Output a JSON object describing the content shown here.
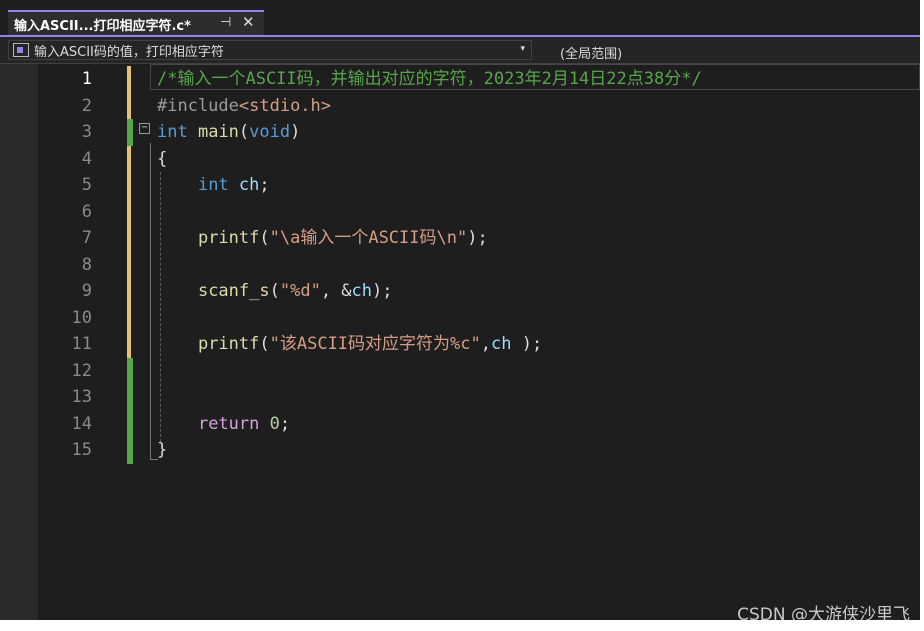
{
  "tab": {
    "title": "输入ASCII...打印相应字符.c*",
    "pin_glyph": "⊣",
    "close_glyph": "✕",
    "accent_color": "#9184ee"
  },
  "navbar": {
    "scope_text": "输入ASCII码的值，打印相应字符",
    "dropdown_arrow": "▾",
    "global_scope": "(全局范围)"
  },
  "editor": {
    "line_numbers": [
      "1",
      "2",
      "3",
      "4",
      "5",
      "6",
      "7",
      "8",
      "9",
      "10",
      "11",
      "12",
      "13",
      "14",
      "15"
    ],
    "active_line": 1,
    "fold_glyph": "−",
    "lines": [
      [
        {
          "t": "/*输入一个ASCII码，并输出对应的字符，2023年2月14日22点38分*/",
          "c": "c-comment"
        }
      ],
      [
        {
          "t": "#include",
          "c": "c-pre"
        },
        {
          "t": "<stdio.h>",
          "c": "c-header"
        }
      ],
      [
        {
          "t": "int",
          "c": "c-type"
        },
        {
          "t": " ",
          "c": "c-punct"
        },
        {
          "t": "main",
          "c": "c-func"
        },
        {
          "t": "(",
          "c": "c-punct"
        },
        {
          "t": "void",
          "c": "c-type"
        },
        {
          "t": ")",
          "c": "c-punct"
        }
      ],
      [
        {
          "t": "{",
          "c": "c-punct"
        }
      ],
      [
        {
          "t": "    ",
          "c": "c-punct"
        },
        {
          "t": "int",
          "c": "c-type"
        },
        {
          "t": " ",
          "c": "c-punct"
        },
        {
          "t": "ch",
          "c": "c-var"
        },
        {
          "t": ";",
          "c": "c-punct"
        }
      ],
      [],
      [
        {
          "t": "    ",
          "c": "c-punct"
        },
        {
          "t": "printf",
          "c": "c-func"
        },
        {
          "t": "(",
          "c": "c-punct"
        },
        {
          "t": "\"\\a输入一个ASCII码\\n\"",
          "c": "c-str"
        },
        {
          "t": ");",
          "c": "c-punct"
        }
      ],
      [],
      [
        {
          "t": "    ",
          "c": "c-punct"
        },
        {
          "t": "scanf_s",
          "c": "c-func"
        },
        {
          "t": "(",
          "c": "c-punct"
        },
        {
          "t": "\"%d\"",
          "c": "c-str"
        },
        {
          "t": ", &",
          "c": "c-punct"
        },
        {
          "t": "ch",
          "c": "c-var"
        },
        {
          "t": ");",
          "c": "c-punct"
        }
      ],
      [],
      [
        {
          "t": "    ",
          "c": "c-punct"
        },
        {
          "t": "printf",
          "c": "c-func"
        },
        {
          "t": "(",
          "c": "c-punct"
        },
        {
          "t": "\"该ASCII码对应字符为%c\"",
          "c": "c-str"
        },
        {
          "t": ",",
          "c": "c-punct"
        },
        {
          "t": "ch",
          "c": "c-var"
        },
        {
          "t": " );",
          "c": "c-punct"
        }
      ],
      [],
      [],
      [
        {
          "t": "    ",
          "c": "c-punct"
        },
        {
          "t": "return",
          "c": "c-kw"
        },
        {
          "t": " ",
          "c": "c-punct"
        },
        {
          "t": "0",
          "c": "c-num"
        },
        {
          "t": ";",
          "c": "c-punct"
        }
      ],
      [
        {
          "t": "}",
          "c": "c-punct"
        }
      ]
    ],
    "change_markers": [
      {
        "line": 1,
        "state": "yellow"
      },
      {
        "line": 2,
        "state": "yellow"
      },
      {
        "line": 3,
        "state": "green"
      },
      {
        "line": 4,
        "state": "yellow"
      },
      {
        "line": 5,
        "state": "yellow"
      },
      {
        "line": 6,
        "state": "yellow"
      },
      {
        "line": 7,
        "state": "yellow"
      },
      {
        "line": 8,
        "state": "yellow"
      },
      {
        "line": 9,
        "state": "yellow"
      },
      {
        "line": 10,
        "state": "yellow"
      },
      {
        "line": 11,
        "state": "yellow"
      },
      {
        "line": 12,
        "state": "green"
      },
      {
        "line": 13,
        "state": "green"
      },
      {
        "line": 14,
        "state": "green"
      },
      {
        "line": 15,
        "state": "green"
      }
    ]
  },
  "watermark": "CSDN @大游侠沙里飞"
}
